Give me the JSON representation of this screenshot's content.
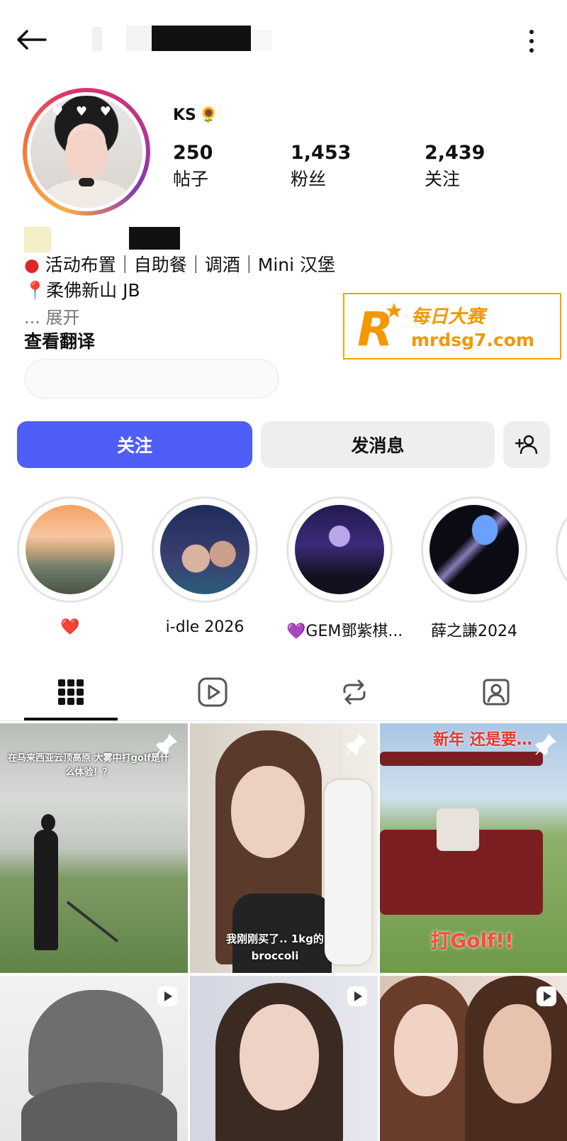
{
  "header": {
    "back_icon": "arrow-left-icon",
    "more_icon": "more-vertical-icon"
  },
  "profile": {
    "username": "KS",
    "username_emoji": "🌻",
    "stats": [
      {
        "value": "250",
        "label": "帖子"
      },
      {
        "value": "1,453",
        "label": "粉丝"
      },
      {
        "value": "2,439",
        "label": "关注"
      }
    ],
    "bio_lines": [
      "活动布置｜自助餐｜调酒｜Mini 汉堡",
      "📍柔佛新山 JB"
    ],
    "bio_more": "... 展开",
    "translate": "查看翻译"
  },
  "watermark": {
    "line1": "每日大赛",
    "line2": "mrdsg7.com",
    "color": "#f39800"
  },
  "actions": {
    "follow": "关注",
    "message": "发消息",
    "add_user_icon": "person-add-icon",
    "follow_color": "#4f5ef7"
  },
  "highlights": [
    {
      "label": "❤️"
    },
    {
      "label": "i-dle 2026"
    },
    {
      "label": "💜GEM鄧紫棋..."
    },
    {
      "label": "薛之謙2024"
    }
  ],
  "tabs": [
    {
      "name": "grid",
      "icon": "grid-icon",
      "active": true
    },
    {
      "name": "reels",
      "icon": "reels-icon",
      "active": false
    },
    {
      "name": "reposts",
      "icon": "repost-icon",
      "active": false
    },
    {
      "name": "tagged",
      "icon": "tagged-icon",
      "active": false
    }
  ],
  "posts": [
    {
      "type": "pinned",
      "caption_top": "在马来西亚云顶高原 大雾中打golf是什么体验！？",
      "caption_bottom": ""
    },
    {
      "type": "pinned",
      "caption_top": "",
      "caption_bottom": "我刚刚买了.. 1kg的broccoli"
    },
    {
      "type": "pinned",
      "caption_top": "新年 还是要…",
      "caption_bottom": "打Golf!!"
    },
    {
      "type": "reel",
      "caption_top": "",
      "caption_bottom": ""
    },
    {
      "type": "reel",
      "caption_top": "",
      "caption_bottom": ""
    },
    {
      "type": "reel",
      "caption_top": "",
      "caption_bottom": ""
    }
  ]
}
